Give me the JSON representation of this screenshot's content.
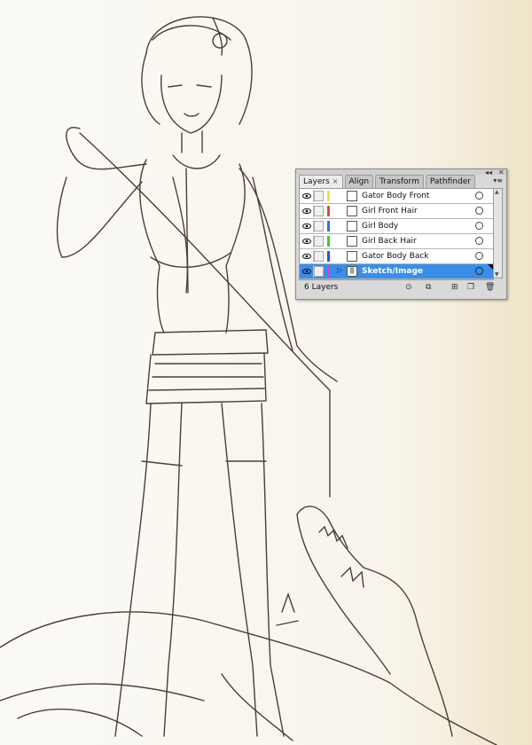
{
  "layers_panel": {
    "tabs": [
      {
        "label": "Layers",
        "active": true
      },
      {
        "label": "Align",
        "active": false
      },
      {
        "label": "Transform",
        "active": false
      },
      {
        "label": "Pathfinder",
        "active": false
      }
    ],
    "close_glyph": "×",
    "layers": [
      {
        "name": "Gator Body Front",
        "color": "#f2e13a",
        "selected": false
      },
      {
        "name": "Girl Front Hair",
        "color": "#e84a3a",
        "selected": false
      },
      {
        "name": "Girl Body",
        "color": "#3a6ae8",
        "selected": false
      },
      {
        "name": "Girl Back Hair",
        "color": "#3ac84a",
        "selected": false
      },
      {
        "name": "Gator Body Back",
        "color": "#3a4ae8",
        "selected": false
      },
      {
        "name": "Sketch/Image",
        "color": "#e83ad8",
        "selected": true
      }
    ],
    "footer_count": "6 Layers"
  },
  "colors": {
    "sketch_ink": "#3b2a22",
    "paper": "#f7f3ea",
    "selection": "#3a8ee8"
  }
}
